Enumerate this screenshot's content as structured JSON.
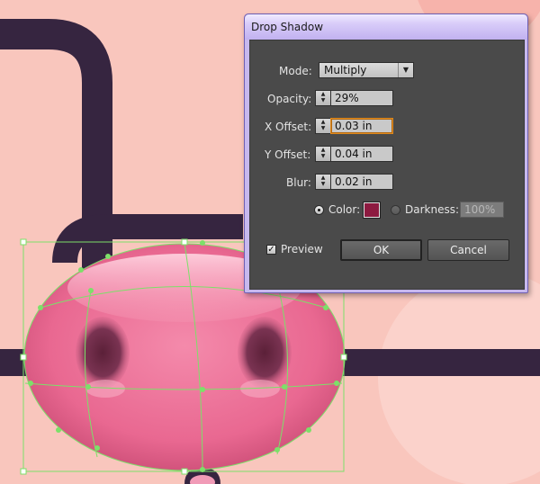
{
  "dialog": {
    "title": "Drop Shadow",
    "mode_label": "Mode:",
    "mode_value": "Multiply",
    "opacity_label": "Opacity:",
    "opacity_value": "29%",
    "x_offset_label": "X Offset:",
    "x_offset_value": "0.03 in",
    "y_offset_label": "Y Offset:",
    "y_offset_value": "0.04 in",
    "blur_label": "Blur:",
    "blur_value": "0.02 in",
    "color_label": "Color:",
    "darkness_label": "Darkness:",
    "darkness_value": "100%",
    "preview_label": "Preview",
    "ok_label": "OK",
    "cancel_label": "Cancel",
    "shadow_color": "#8d1a40",
    "preview_checked": true,
    "color_option_selected": true
  },
  "colors": {
    "background": "#f9c6bd",
    "pipe": "#362540",
    "snout_pink": "#ea6f94",
    "nostril": "#6d2b45",
    "selection_path": "#7de069",
    "dialog_panel": "#4a4a4a",
    "dialog_title_gradient": "#c7b8ee"
  },
  "icons": {
    "spin": "up-down-arrows",
    "dropdown": "triangle-down",
    "checkmark": "check"
  }
}
